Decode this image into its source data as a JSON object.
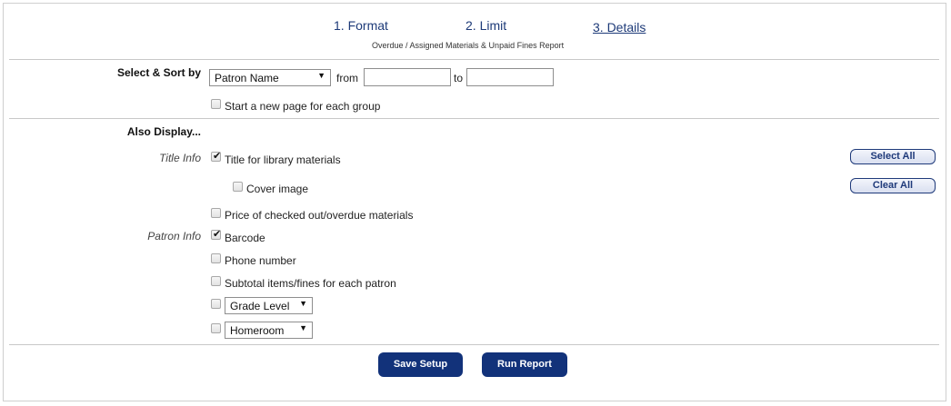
{
  "steps": [
    {
      "label": "1. Format"
    },
    {
      "label": "2. Limit"
    },
    {
      "label": "3. Details"
    }
  ],
  "subtitle": "Overdue / Assigned Materials & Unpaid Fines Report",
  "select_sort": {
    "label": "Select & Sort by",
    "selected": "Patron Name",
    "from_label": "from",
    "to_label": "to",
    "from_value": "",
    "to_value": "",
    "new_page_label": "Start a new page for each group",
    "new_page_checked": false
  },
  "also_display": {
    "heading": "Also Display...",
    "title_info_label": "Title Info",
    "patron_info_label": "Patron Info",
    "title_materials": {
      "label": "Title for library materials",
      "checked": true
    },
    "cover_image": {
      "label": "Cover image",
      "checked": false
    },
    "price": {
      "label": "Price of checked out/overdue materials",
      "checked": false
    },
    "barcode": {
      "label": "Barcode",
      "checked": true
    },
    "phone": {
      "label": "Phone number",
      "checked": false
    },
    "subtotal": {
      "label": "Subtotal items/fines for each patron",
      "checked": false
    },
    "grade_level": {
      "selected": "Grade Level",
      "checked": false
    },
    "homeroom": {
      "selected": "Homeroom",
      "checked": false
    }
  },
  "side_buttons": {
    "select_all": "Select All",
    "clear_all": "Clear All"
  },
  "actions": {
    "save_setup": "Save Setup",
    "run_report": "Run Report"
  },
  "colors": {
    "accent": "#12327a",
    "link": "#1d3a78"
  }
}
